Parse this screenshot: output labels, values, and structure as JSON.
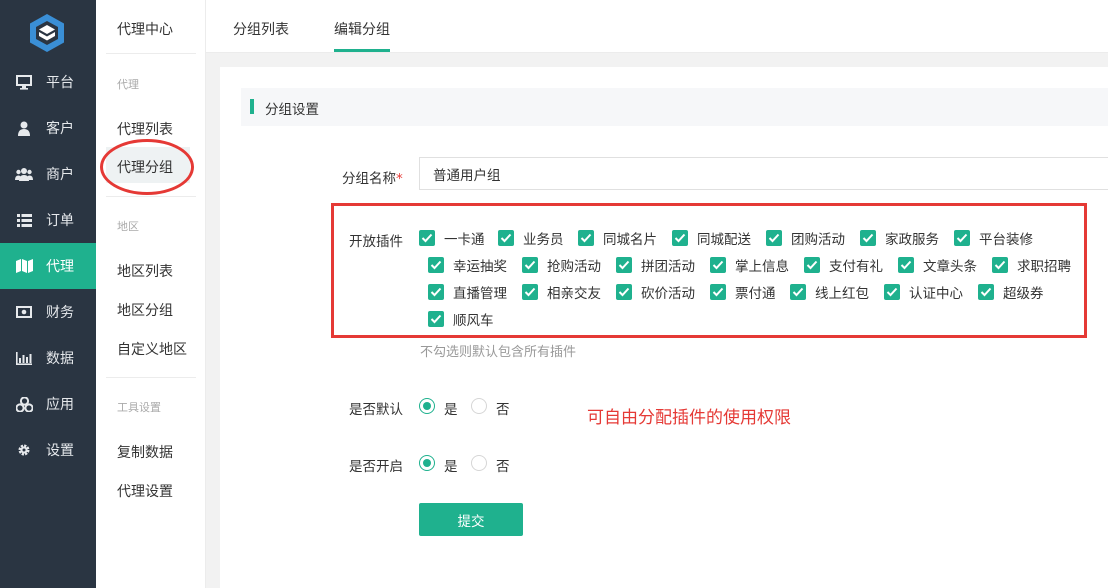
{
  "sidebar": {
    "items": [
      {
        "label": "平台",
        "icon": "monitor-icon"
      },
      {
        "label": "客户",
        "icon": "user-icon"
      },
      {
        "label": "商户",
        "icon": "users-icon"
      },
      {
        "label": "订单",
        "icon": "list-icon"
      },
      {
        "label": "代理",
        "icon": "map-icon",
        "active": true
      },
      {
        "label": "财务",
        "icon": "money-icon"
      },
      {
        "label": "数据",
        "icon": "bar-chart-icon"
      },
      {
        "label": "应用",
        "icon": "apps-icon"
      },
      {
        "label": "设置",
        "icon": "gear-icon"
      }
    ]
  },
  "subnav": {
    "title": "代理中心",
    "group1": "代理",
    "link_agent_list": "代理列表",
    "link_agent_group": "代理分组",
    "group2": "地区",
    "link_region_list": "地区列表",
    "link_region_group": "地区分组",
    "link_custom_region": "自定义地区",
    "group3": "工具设置",
    "link_copy_data": "复制数据",
    "link_agent_settings": "代理设置"
  },
  "tabs": {
    "group_list": "分组列表",
    "edit_group": "编辑分组"
  },
  "form": {
    "section_title": "分组设置",
    "name_label": "分组名称",
    "name_required": "*",
    "name_value": "普通用户组",
    "plugins_label": "开放插件",
    "plugins": [
      "一卡通",
      "业务员",
      "同城名片",
      "同城配送",
      "团购活动",
      "家政服务",
      "平台装修",
      "幸运抽奖",
      "抢购活动",
      "拼团活动",
      "掌上信息",
      "支付有礼",
      "文章头条",
      "求职招聘",
      "直播管理",
      "相亲交友",
      "砍价活动",
      "票付通",
      "线上红包",
      "认证中心",
      "超级券",
      "顺风车"
    ],
    "plugins_hint": "不勾选则默认包含所有插件",
    "default_label": "是否默认",
    "enabled_label": "是否开启",
    "yes": "是",
    "no": "否",
    "default_value": "是",
    "enabled_value": "是",
    "submit": "提交"
  },
  "annotation": "可自由分配插件的使用权限",
  "colors": {
    "accent": "#1fb18e",
    "sidebar_bg": "#2a3542",
    "annotation": "#e53935"
  }
}
